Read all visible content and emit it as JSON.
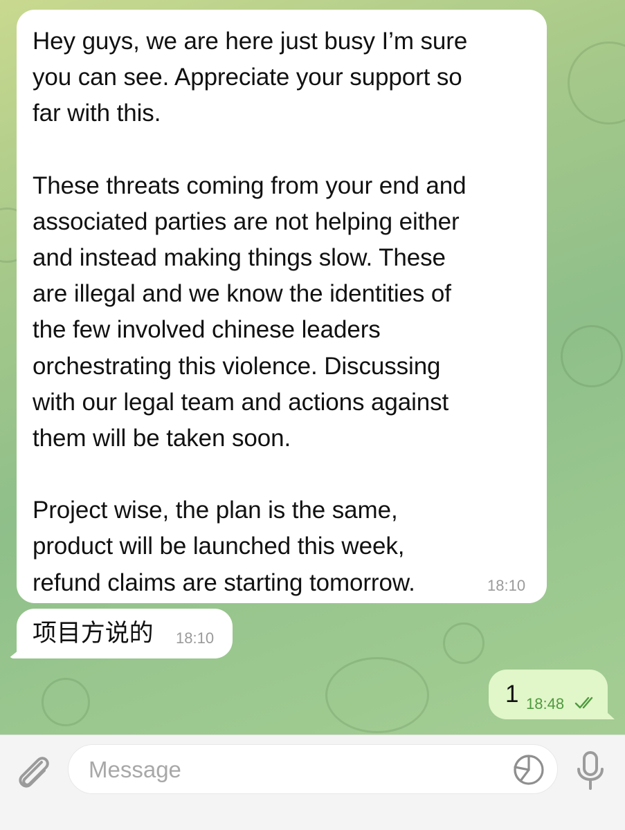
{
  "messages": {
    "incoming_1": {
      "paragraphs": [
        [
          "Hey guys, we are here just busy I’m sure",
          "you can see. Appreciate your support so",
          "far with this."
        ],
        [
          "These threats coming from your end and",
          "associated parties are not helping either",
          "and instead making things slow. These",
          "are illegal and we know the identities of",
          "the few involved chinese leaders",
          "orchestrating this violence. Discussing",
          "with our legal team and actions against",
          "them will be taken soon."
        ],
        [
          "Project wise, the plan is the same,",
          "product will be launched this week,",
          "refund claims are starting tomorrow."
        ]
      ],
      "time": "18:10"
    },
    "incoming_2": {
      "text": "项目方说的",
      "time": "18:10"
    },
    "outgoing_1": {
      "text": "1",
      "time": "18:48",
      "status_icon": "double-check-icon"
    }
  },
  "composer": {
    "placeholder": "Message",
    "icons": [
      "paperclip-icon",
      "sticker-icon",
      "microphone-icon"
    ]
  },
  "colors": {
    "incoming_bubble": "#ffffff",
    "outgoing_bubble": "#e1f6c9",
    "outgoing_time": "#4f9a3f",
    "timestamp_gray": "#9a9a9a",
    "composer_bg": "#f4f4f4"
  }
}
